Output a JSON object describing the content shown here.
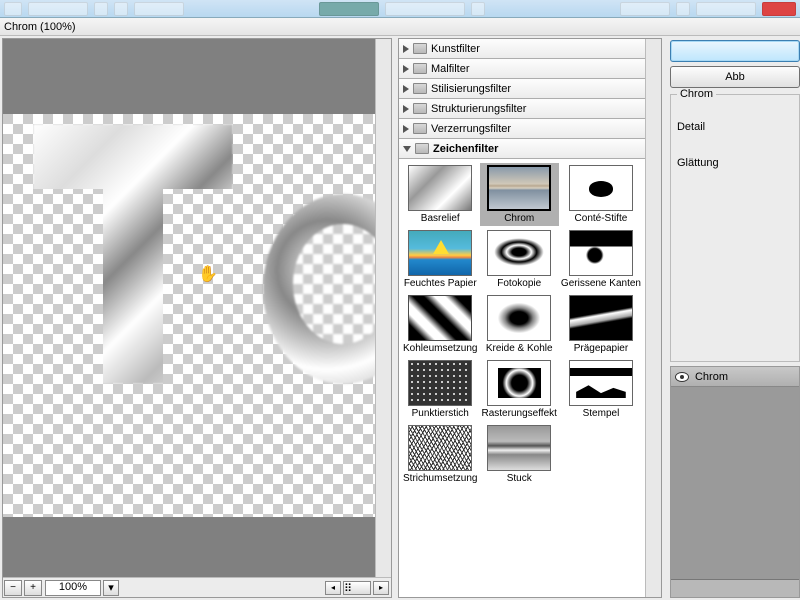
{
  "titlebar": {
    "text": "Chrom (100%)"
  },
  "zoom": {
    "minus": "−",
    "plus": "+",
    "value": "100%",
    "dropdown": "▾"
  },
  "scroll": {
    "left": "◂",
    "right": "▸",
    "thumb": "⠿"
  },
  "tree": {
    "categories": [
      {
        "label": "Kunstfilter",
        "expanded": false
      },
      {
        "label": "Malfilter",
        "expanded": false
      },
      {
        "label": "Stilisierungsfilter",
        "expanded": false
      },
      {
        "label": "Strukturierungsfilter",
        "expanded": false
      },
      {
        "label": "Verzerrungsfilter",
        "expanded": false
      },
      {
        "label": "Zeichenfilter",
        "expanded": true
      }
    ],
    "thumbs": [
      {
        "label": "Basrelief",
        "cls": "t-basrelief"
      },
      {
        "label": "Chrom",
        "cls": "t-chrom",
        "selected": true
      },
      {
        "label": "Conté-Stifte",
        "cls": "t-conte"
      },
      {
        "label": "Feuchtes Papier",
        "cls": "t-feucht"
      },
      {
        "label": "Fotokopie",
        "cls": "t-fotokopie"
      },
      {
        "label": "Gerissene Kanten",
        "cls": "t-gerissen"
      },
      {
        "label": "Kohleumsetzung",
        "cls": "t-kohle"
      },
      {
        "label": "Kreide & Kohle",
        "cls": "t-kreide"
      },
      {
        "label": "Prägepapier",
        "cls": "t-praege"
      },
      {
        "label": "Punktierstich",
        "cls": "t-punktier"
      },
      {
        "label": "Rasterungseffekt",
        "cls": "t-raster"
      },
      {
        "label": "Stempel",
        "cls": "t-stempel"
      },
      {
        "label": "Strichumsetzung",
        "cls": "t-strich"
      },
      {
        "label": "Stuck",
        "cls": "t-stuck"
      }
    ]
  },
  "buttons": {
    "ok": "",
    "cancel": "Abb"
  },
  "settings": {
    "group_title": "Chrom",
    "detail_label": "Detail",
    "smooth_label": "Glättung"
  },
  "layers": {
    "active_name": "Chrom"
  }
}
